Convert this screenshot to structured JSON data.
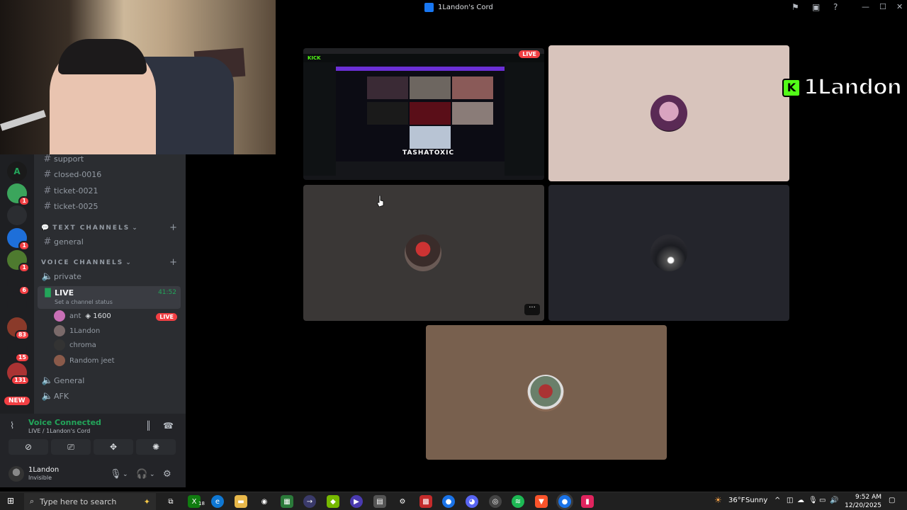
{
  "window": {
    "title": "1Landon's Cord",
    "icons": [
      "inbox-icon",
      "screen-share-icon",
      "help-icon"
    ],
    "controls": [
      "minimize-icon",
      "maximize-icon",
      "close-icon"
    ]
  },
  "server_rail": {
    "servers": [
      {
        "letter": "A",
        "color": "#1a1a1a",
        "text_color": "#23a55a",
        "badge": ""
      },
      {
        "letter": "",
        "color": "#3ba55c",
        "badge": "1"
      },
      {
        "letter": "",
        "color": "#2b2d31",
        "badge": ""
      },
      {
        "letter": "",
        "color": "#1e6fd9",
        "badge": "1"
      },
      {
        "letter": "",
        "color": "#4e7a2f",
        "badge": "1"
      },
      {
        "letter": "",
        "color": "#1e1f22",
        "badge": "6"
      },
      {
        "letter": "",
        "color": "#1e1f22",
        "badge": ""
      },
      {
        "letter": "",
        "color": "#8a3a2a",
        "badge": "83"
      },
      {
        "letter": "",
        "color": "#1e1f22",
        "badge": "15"
      },
      {
        "letter": "",
        "color": "#a33",
        "badge": "131"
      }
    ],
    "new_label": "NEW"
  },
  "channels": {
    "text_items": [
      "support",
      "closed-0016",
      "ticket-0021",
      "ticket-0025"
    ],
    "text_category": "TEXT CHANNELS",
    "general_text": "general",
    "voice_category": "VOICE CHANNELS",
    "private": "private",
    "live": {
      "name": "LIVE",
      "time": "41:52",
      "status": "Set a channel status"
    },
    "voice_users": [
      {
        "name": "ant",
        "extra": "1600",
        "live": "LIVE",
        "color": "#c86fb5"
      },
      {
        "name": "1Landon",
        "extra": "",
        "live": "",
        "color": "#7a6a6a"
      },
      {
        "name": "chroma",
        "extra": "",
        "live": "",
        "color": "#333"
      },
      {
        "name": "Random jeet",
        "extra": "",
        "live": "",
        "color": "#8a5a4a"
      }
    ],
    "general_voice": "General",
    "afk": "AFK"
  },
  "voice_panel": {
    "status": "Voice Connected",
    "sub": "LIVE / 1Landon's Cord",
    "user_name": "1Landon",
    "user_status": "Invisible"
  },
  "stream": {
    "live": "LIVE",
    "streamer": "TASHATOXIC",
    "kick": "KICK"
  },
  "overlay": {
    "k": "K",
    "name": "1Landon"
  },
  "tiles_colors": {
    "tile1": "#d8c4bc",
    "tile2": "#3a3736",
    "tile3": "#24252c",
    "tile4": "#78604e"
  },
  "taskbar": {
    "search_placeholder": "Type here to search",
    "weather_temp": "36°F",
    "weather_text": "Sunny",
    "time": "9:52 AM",
    "date": "12/20/2025",
    "xbox_badge": "18"
  }
}
